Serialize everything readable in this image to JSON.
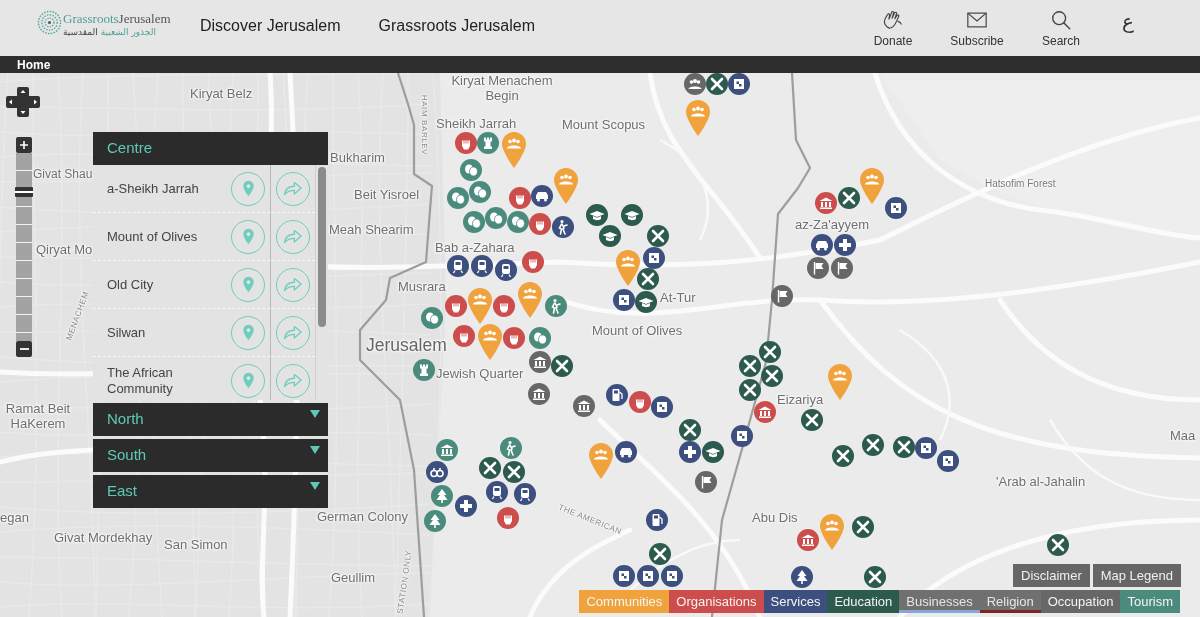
{
  "header": {
    "logo": {
      "wordmark": {
        "part_1": "Grassroots",
        "part_2": "Jerusalem"
      },
      "arabic": {
        "part_1": "الجذور الشعبية",
        "part_2": "المقدسية"
      }
    },
    "nav": [
      {
        "label": "Discover Jerusalem"
      },
      {
        "label": "Grassroots Jerusalem"
      }
    ],
    "actions": [
      {
        "kind": "donate",
        "label": "Donate"
      },
      {
        "kind": "subscribe",
        "label": "Subscribe"
      },
      {
        "kind": "search",
        "label": "Search"
      },
      {
        "kind": "language",
        "label": "ع"
      }
    ]
  },
  "breadcrumb": {
    "label": "Home"
  },
  "map": {
    "zoom": {
      "level": 0.81
    },
    "labels": [
      {
        "kind": "place",
        "text": "Kiryat Belz"
      },
      {
        "kind": "place",
        "text": "Kiryat Menachem Begin"
      },
      {
        "kind": "street",
        "text": "HAIM BARLEV"
      },
      {
        "kind": "place",
        "text": "Sheikh Jarrah"
      },
      {
        "kind": "place",
        "text": "Mount Scopus"
      },
      {
        "kind": "place",
        "text": "Bukharim"
      },
      {
        "kind": "place",
        "text": "Givat Shau"
      },
      {
        "kind": "place",
        "text": "Beit Yisroel"
      },
      {
        "kind": "area",
        "text": "Hatsofim Forest"
      },
      {
        "kind": "place",
        "text": "Meah Shearim"
      },
      {
        "kind": "place",
        "text": "az-Za'ayyem"
      },
      {
        "kind": "place",
        "text": "Qiryat Mo"
      },
      {
        "kind": "place",
        "text": "Bab a-Zahara"
      },
      {
        "kind": "place",
        "text": "Musrara"
      },
      {
        "kind": "place",
        "text": "At-Tur"
      },
      {
        "kind": "street",
        "text": "MENACHEM"
      },
      {
        "kind": "city",
        "text": "Jerusalem"
      },
      {
        "kind": "place",
        "text": "Mount of Olives"
      },
      {
        "kind": "place",
        "text": "Jewish Quarter"
      },
      {
        "kind": "place",
        "text": "Ramat Beit HaKerem"
      },
      {
        "kind": "place",
        "text": "Eizariya"
      },
      {
        "kind": "place",
        "text": "Maa"
      },
      {
        "kind": "place",
        "text": "'Arab al-Jahalin"
      },
      {
        "kind": "place",
        "text": "egan"
      },
      {
        "kind": "place",
        "text": "German Colony"
      },
      {
        "kind": "street",
        "text": "THE AMERICAN"
      },
      {
        "kind": "place",
        "text": "Abu Dis"
      },
      {
        "kind": "place",
        "text": "Givat Mordekhay"
      },
      {
        "kind": "place",
        "text": "San Simon"
      },
      {
        "kind": "place",
        "text": "Geullim"
      },
      {
        "kind": "street",
        "text": "STATION ONLY"
      }
    ]
  },
  "panel": {
    "sections": [
      {
        "title": "Centre",
        "expanded": true,
        "items": [
          {
            "name": "a-Sheikh Jarrah"
          },
          {
            "name": "Mount of Olives"
          },
          {
            "name": "Old City"
          },
          {
            "name": "Silwan"
          },
          {
            "name": "The African Community"
          }
        ]
      },
      {
        "title": "North",
        "expanded": false
      },
      {
        "title": "South",
        "expanded": false
      },
      {
        "title": "East",
        "expanded": false
      }
    ]
  },
  "map_buttons": [
    {
      "label": "Disclaimer"
    },
    {
      "label": "Map Legend"
    }
  ],
  "categories": [
    {
      "label": "Communities",
      "color": "#f0a23c",
      "selected": true
    },
    {
      "label": "Organisations",
      "color": "#cc4d4b",
      "selected": true
    },
    {
      "label": "Services",
      "color": "#3d4f7f",
      "selected": true
    },
    {
      "label": "Education",
      "color": "#2c5a4f",
      "selected": true
    },
    {
      "label": "Businesses",
      "color": "#86a6d6",
      "selected": false
    },
    {
      "label": "Religion",
      "color": "#7e2424",
      "selected": false
    },
    {
      "label": "Occupation",
      "color": "#676767",
      "selected": true
    },
    {
      "label": "Tourism",
      "color": "#4b8b7d",
      "selected": true
    }
  ]
}
